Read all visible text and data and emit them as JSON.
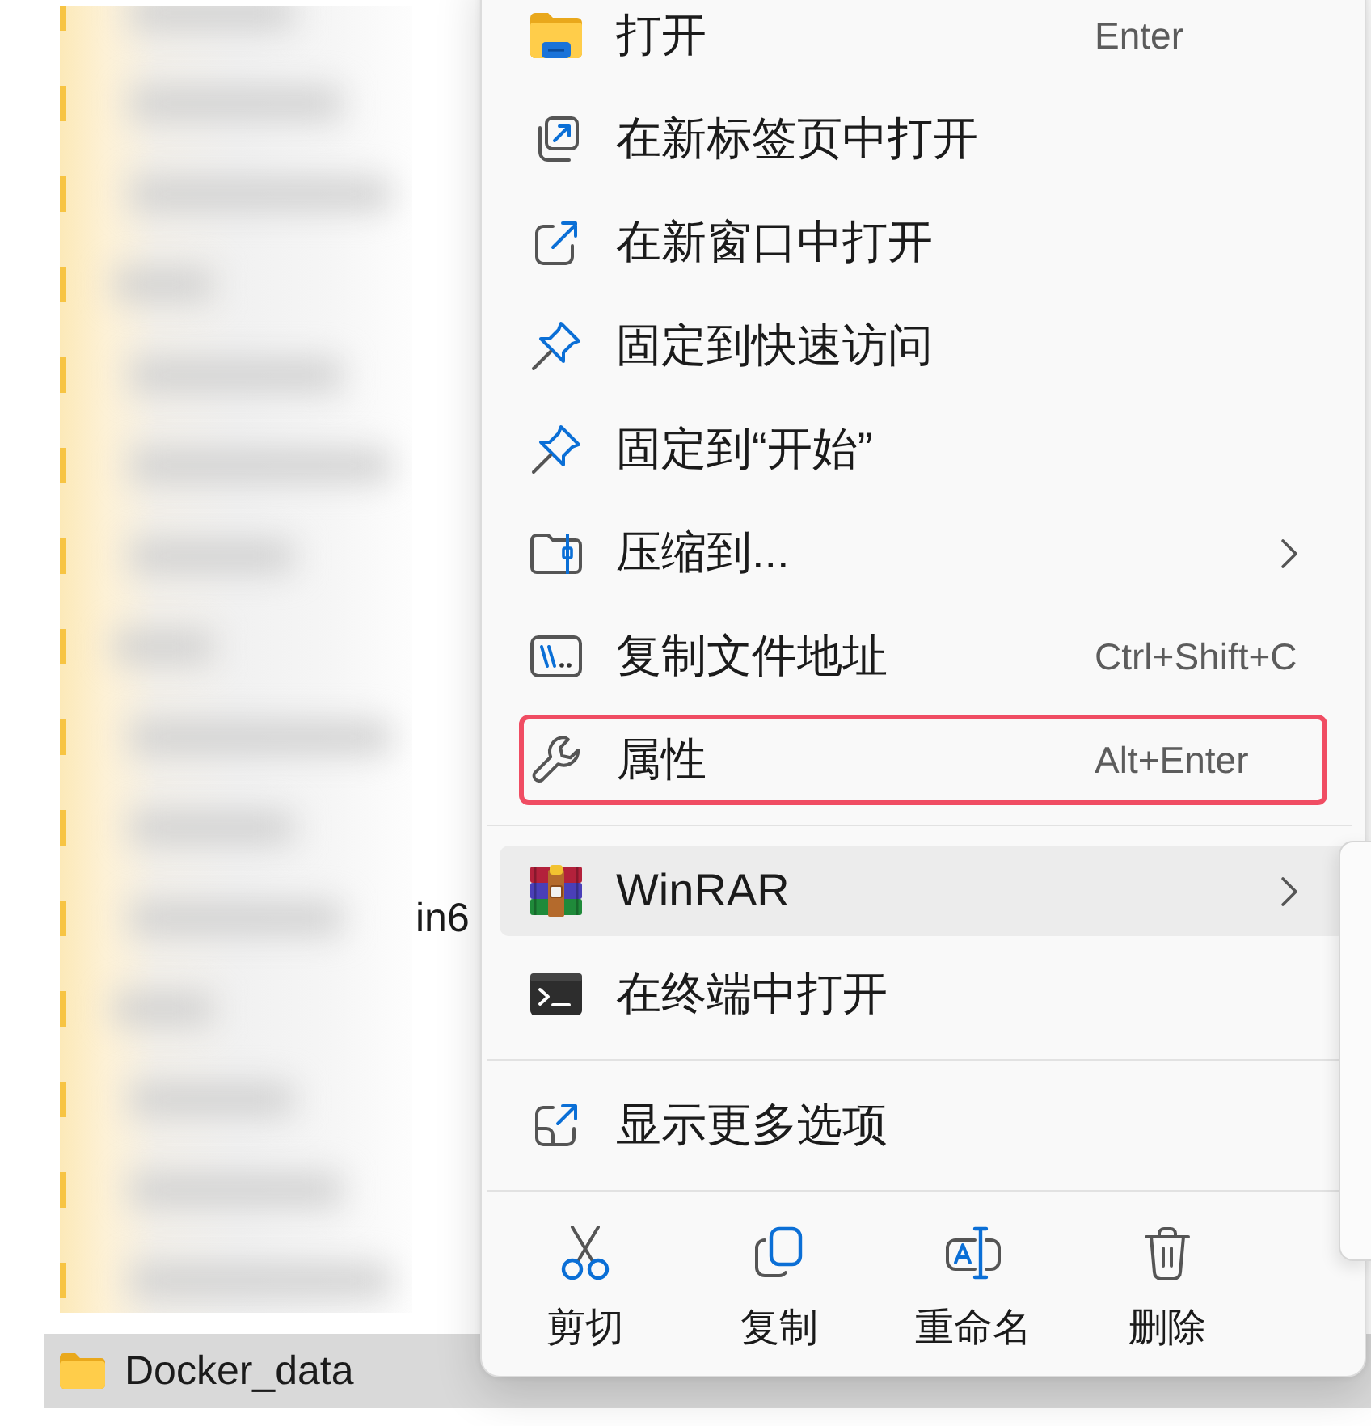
{
  "file_list": {
    "partly_hidden_name": "in6",
    "rows": [
      {
        "name": "Docker_data",
        "selected": true
      }
    ]
  },
  "context_menu": {
    "groups": [
      {
        "items": [
          {
            "label": "打开",
            "shortcut": "Enter",
            "has_submenu": false,
            "hovered": false,
            "highlighted": false
          },
          {
            "label": "在新标签页中打开",
            "has_submenu": false,
            "hovered": false,
            "highlighted": false
          },
          {
            "label": "在新窗口中打开",
            "has_submenu": false,
            "hovered": false,
            "highlighted": false
          },
          {
            "label": "固定到快速访问",
            "has_submenu": false,
            "hovered": false,
            "highlighted": false
          },
          {
            "label": "固定到“开始”",
            "has_submenu": false,
            "hovered": false,
            "highlighted": false
          },
          {
            "label": "压缩到...",
            "has_submenu": true,
            "hovered": false,
            "highlighted": false
          },
          {
            "label": "复制文件地址",
            "shortcut": "Ctrl+Shift+C",
            "has_submenu": false,
            "hovered": false,
            "highlighted": false
          },
          {
            "label": "属性",
            "shortcut": "Alt+Enter",
            "has_submenu": false,
            "hovered": false,
            "highlighted": true
          }
        ]
      },
      {
        "items": [
          {
            "label": "WinRAR",
            "has_submenu": true,
            "hovered": true,
            "highlighted": false
          },
          {
            "label": "在终端中打开",
            "has_submenu": false,
            "hovered": false,
            "highlighted": false
          }
        ]
      },
      {
        "items": [
          {
            "label": "显示更多选项",
            "has_submenu": false,
            "hovered": false,
            "highlighted": false
          }
        ]
      }
    ],
    "actions": [
      {
        "label": "剪切"
      },
      {
        "label": "复制"
      },
      {
        "label": "重命名"
      },
      {
        "label": "删除"
      }
    ]
  }
}
